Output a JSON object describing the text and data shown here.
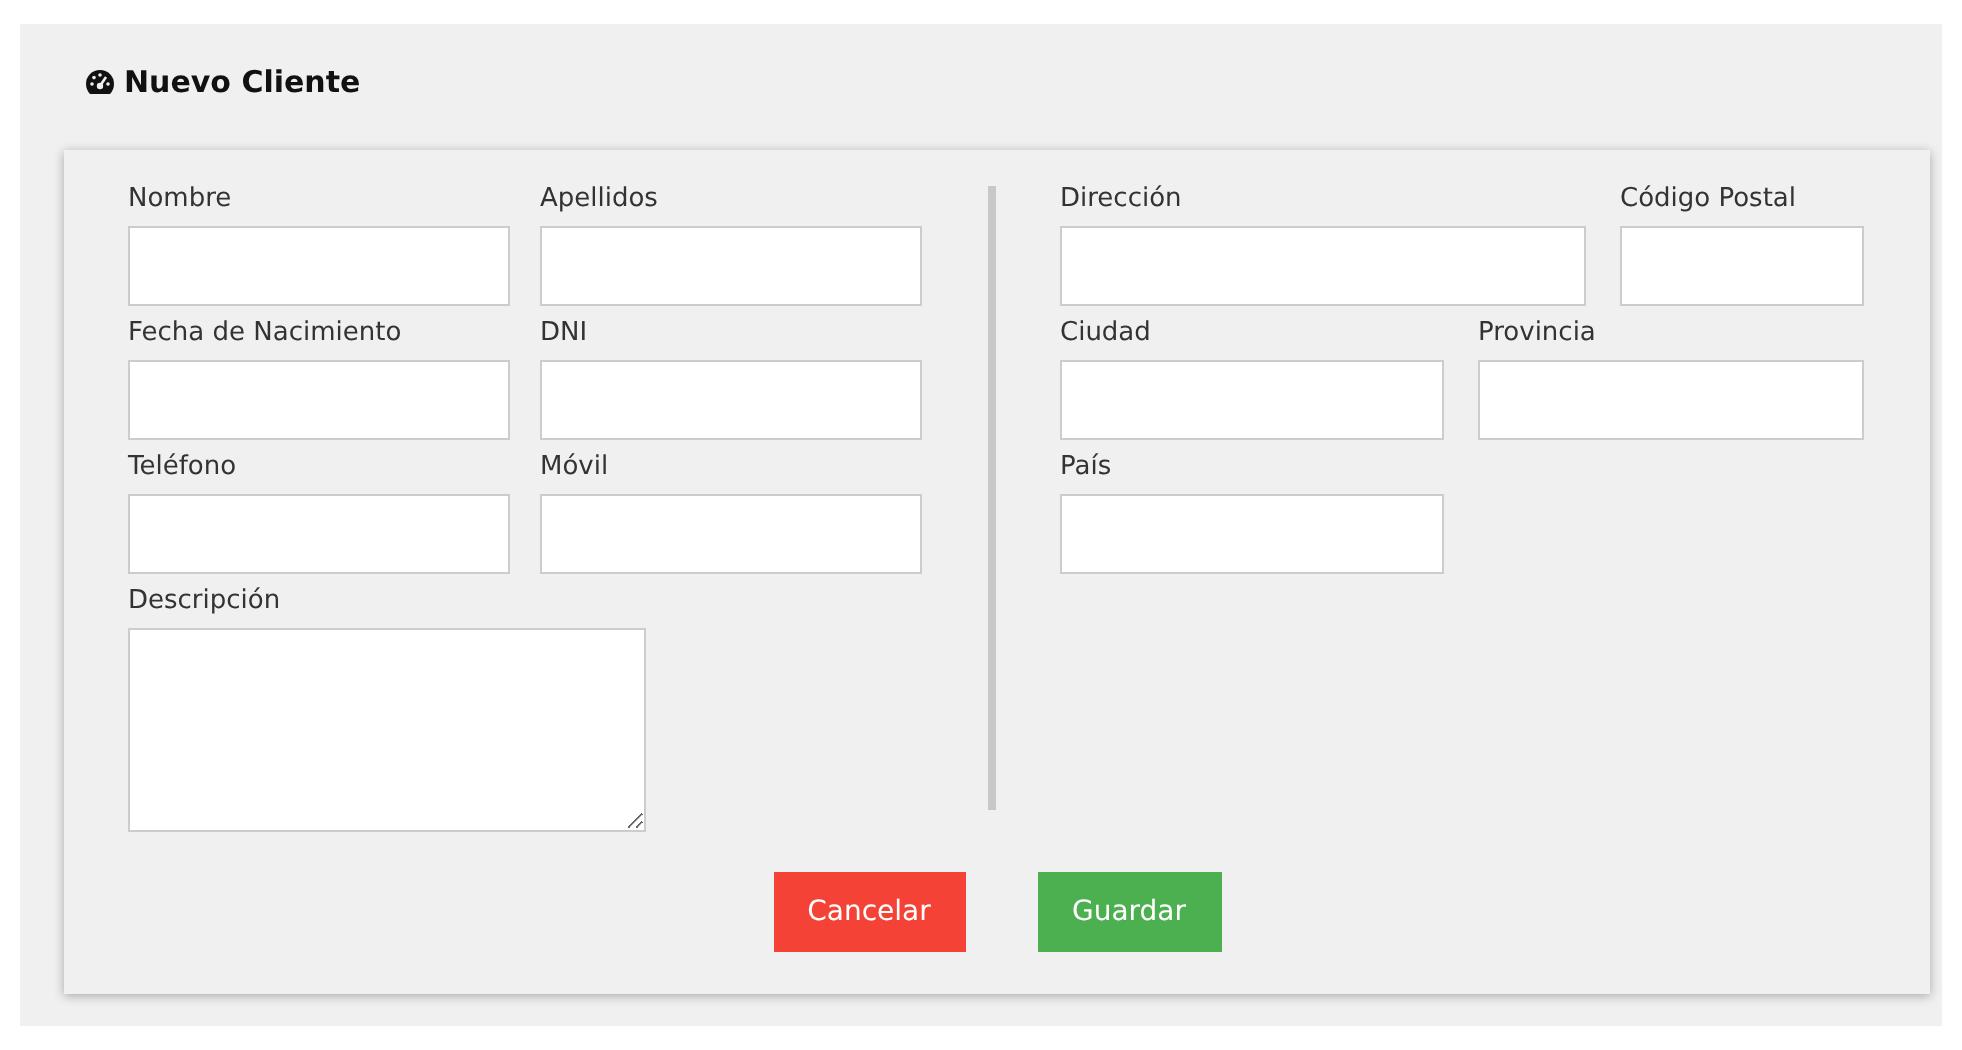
{
  "title": "Nuevo Cliente",
  "left_rows": [
    [
      {
        "label": "Nombre",
        "kind": "input"
      },
      {
        "label": "Apellidos",
        "kind": "input"
      }
    ],
    [
      {
        "label": "Fecha de Nacimiento",
        "kind": "input"
      },
      {
        "label": "DNI",
        "kind": "input"
      }
    ],
    [
      {
        "label": "Teléfono",
        "kind": "input"
      },
      {
        "label": "Móvil",
        "kind": "input"
      }
    ],
    [
      {
        "label": "Descripción",
        "kind": "textarea"
      }
    ]
  ],
  "right_rows": [
    [
      {
        "label": "Dirección",
        "kind": "input"
      },
      {
        "label": "Código Postal",
        "kind": "input"
      }
    ],
    [
      {
        "label": "Ciudad",
        "kind": "input"
      },
      {
        "label": "Provincia",
        "kind": "input"
      }
    ],
    [
      {
        "label": "País",
        "kind": "input"
      }
    ]
  ],
  "buttons": [
    {
      "label": "Cancelar",
      "kind": "danger"
    },
    {
      "label": "Guardar",
      "kind": "success"
    }
  ]
}
